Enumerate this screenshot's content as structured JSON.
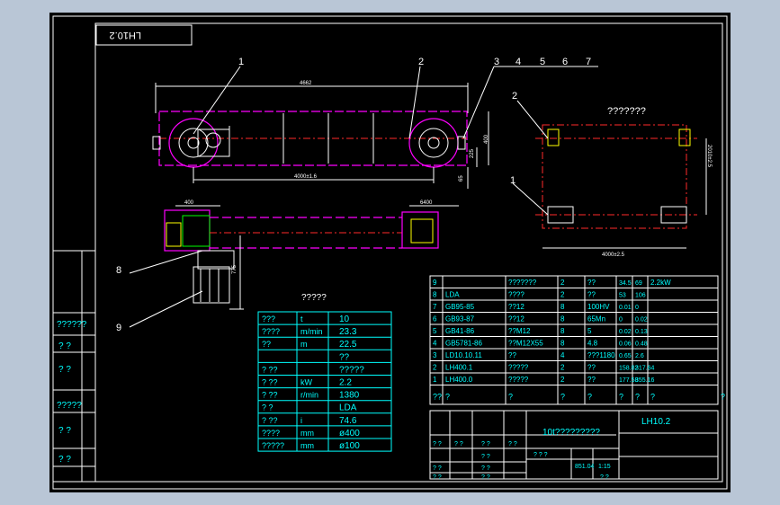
{
  "frame_tag": "LH10.2",
  "callouts": [
    "1",
    "2",
    "3",
    "4",
    "5",
    "6",
    "7",
    "8",
    "9"
  ],
  "dims": {
    "overall_span": "4662",
    "wheel_base": "4000±1.6",
    "height_a": "400",
    "height_b": "225",
    "height_c": "65",
    "top_a": "400",
    "top_b": "6400",
    "side_h": "775",
    "plan_h": "2010±2.5",
    "plan_w": "4000±2.5"
  },
  "plan_title": "???????",
  "param_title": "?????",
  "params": [
    [
      "???",
      "t",
      "10"
    ],
    [
      "????",
      "m/min",
      "23.3"
    ],
    [
      "??",
      "m",
      "22.5"
    ],
    [
      "",
      "",
      "??"
    ],
    [
      "? ??",
      "",
      "?????"
    ],
    [
      "? ??",
      "kW",
      "2.2"
    ],
    [
      "? ??",
      "r/min",
      "1380"
    ],
    [
      "? ?",
      "",
      "LDA"
    ],
    [
      "? ??",
      "i",
      "74.6"
    ],
    [
      "????",
      "mm",
      "ø400"
    ],
    [
      "?????",
      "mm",
      "ø100"
    ]
  ],
  "bom": [
    [
      "9",
      "",
      "???????",
      "2",
      "??",
      "34.5",
      "69",
      "2.2kW"
    ],
    [
      "8",
      "LDA",
      "????",
      "2",
      "??",
      "53",
      "106",
      ""
    ],
    [
      "7",
      "GB95-85",
      "??12",
      "8",
      "100HV",
      "0.01",
      "0",
      ""
    ],
    [
      "6",
      "GB93-87",
      "??12",
      "8",
      "65Mn",
      "0",
      "0.02",
      ""
    ],
    [
      "5",
      "GB41-86",
      "??M12",
      "8",
      "5",
      "0.02",
      "0.13",
      ""
    ],
    [
      "4",
      "GB5781-86",
      "??M12X55",
      "8",
      "4.8",
      "0.06",
      "0.48",
      ""
    ],
    [
      "3",
      "LD10.10.11",
      "??",
      "4",
      "???1180",
      "0.65",
      "2.6",
      ""
    ],
    [
      "2",
      "LH400.1",
      "?????",
      "2",
      "??",
      "158.82",
      "317.64",
      ""
    ],
    [
      "1",
      "LH400.0",
      "?????",
      "2",
      "??",
      "177.58",
      "355.16",
      ""
    ]
  ],
  "bom_header": [
    "??",
    "?",
    "?",
    "?",
    "?",
    "?",
    "?",
    "?",
    "?"
  ],
  "left_strip": [
    "??????",
    "? ?",
    "? ?",
    "?????",
    "? ?",
    "? ?"
  ],
  "title_block": {
    "title": "10t?????????",
    "drawing_no": "LH10.2",
    "scale": "1:15",
    "weight": "851.04",
    "marks": [
      "? ? ?",
      "? ?",
      "? ?",
      "? ?",
      "? ?",
      "? ?",
      "? ?",
      "? ?",
      "? ?",
      "? ?",
      "? ?"
    ]
  },
  "colors": {
    "frame": "#ffffff",
    "text": "#00ffff",
    "outline": "#ff00ff",
    "center": "#ff2a2a"
  }
}
